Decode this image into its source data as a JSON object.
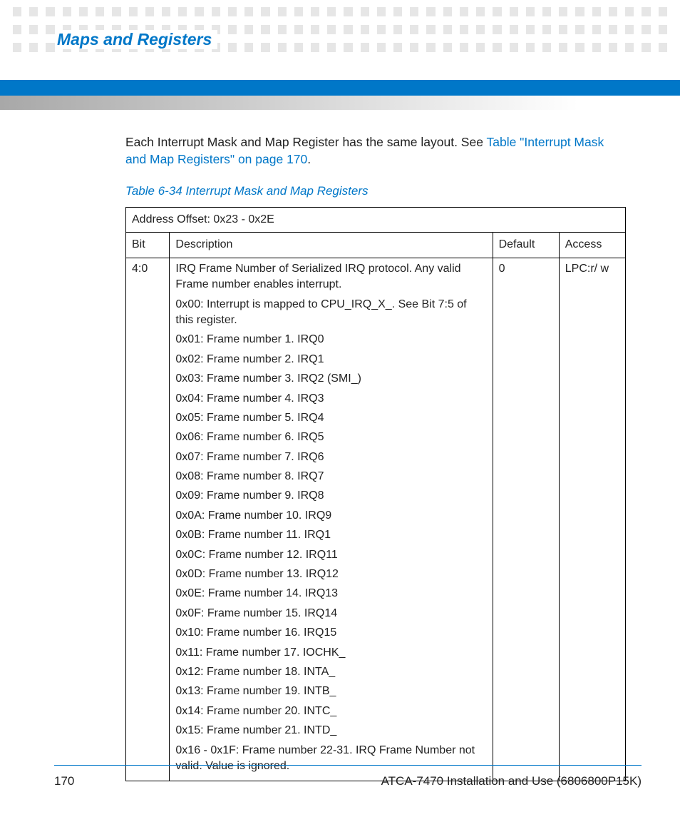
{
  "header": {
    "section_title": "Maps and Registers"
  },
  "intro": {
    "prefix": "Each Interrupt Mask and Map Register has the same layout. See ",
    "link_text": "Table \"Interrupt Mask and Map Registers\" on page 170",
    "suffix": "."
  },
  "table": {
    "caption": "Table 6-34 Interrupt Mask and Map Registers",
    "address_offset": "Address Offset: 0x23 - 0x2E",
    "headers": {
      "bit": "Bit",
      "description": "Description",
      "default": "Default",
      "access": "Access"
    },
    "row": {
      "bit": "4:0",
      "default": "0",
      "access": "LPC:r/ w",
      "lines": [
        "IRQ Frame Number of Serialized IRQ protocol. Any valid Frame number enables interrupt.",
        "0x00: Interrupt is mapped to CPU_IRQ_X_. See Bit 7:5 of this register.",
        "0x01: Frame number 1. IRQ0",
        "0x02: Frame number 2. IRQ1",
        "0x03: Frame number 3. IRQ2 (SMI_)",
        "0x04: Frame number 4. IRQ3",
        "0x05: Frame number 5. IRQ4",
        "0x06: Frame number 6. IRQ5",
        "0x07: Frame number 7. IRQ6",
        "0x08: Frame number 8. IRQ7",
        "0x09: Frame number 9. IRQ8",
        "0x0A: Frame number 10. IRQ9",
        "0x0B: Frame number 11. IRQ1",
        "0x0C: Frame number 12. IRQ11",
        "0x0D: Frame number 13. IRQ12",
        "0x0E: Frame number 14. IRQ13",
        "0x0F: Frame number 15. IRQ14",
        "0x10: Frame number 16. IRQ15",
        "0x11: Frame number 17. IOCHK_",
        "0x12: Frame number 18. INTA_",
        "0x13: Frame number 19. INTB_",
        "0x14: Frame number 20. INTC_",
        "0x15: Frame number 21. INTD_",
        "0x16 - 0x1F: Frame number 22-31. IRQ Frame Number not valid. Value is ignored."
      ]
    }
  },
  "footer": {
    "page_number": "170",
    "doc_title": "ATCA-7470 Installation and Use (6806800P15K)"
  }
}
